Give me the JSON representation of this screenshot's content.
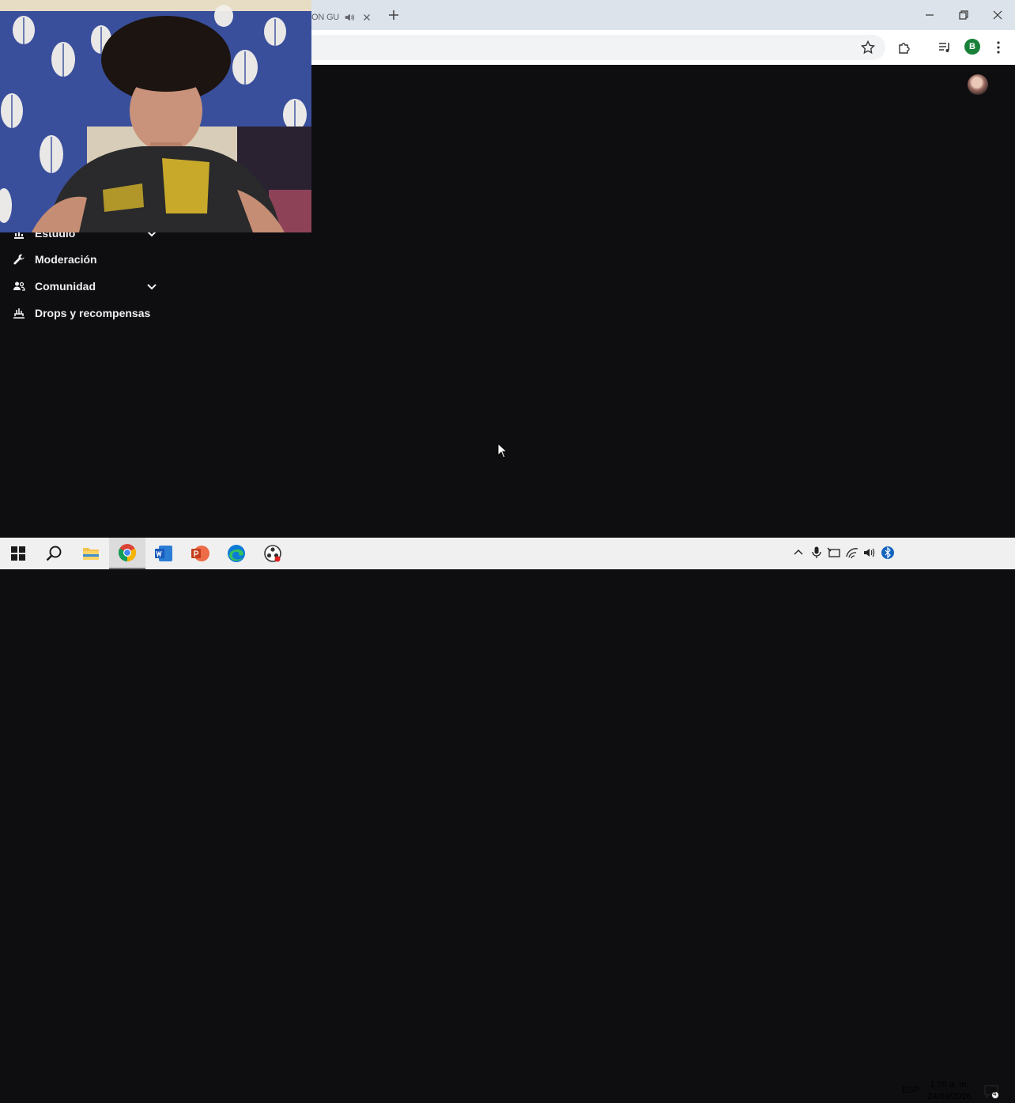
{
  "browser": {
    "tab": {
      "title": "ON GU",
      "audio_icon": "speaker-icon"
    },
    "new_tab_icon": "plus-icon",
    "window_controls": [
      "minimize-icon",
      "restore-icon",
      "close-icon"
    ],
    "toolbar_icons": [
      "star-icon",
      "extensions-icon",
      "media-control-icon",
      "more-menu-icon"
    ],
    "profile_initial": "B",
    "profile_color": "#188038"
  },
  "page": {
    "background": "#0e0e10",
    "sidebar": {
      "items": [
        {
          "label": "Estudio",
          "icon": "chart-icon",
          "has_chevron": true
        },
        {
          "label": "Moderación",
          "icon": "wrench-icon",
          "has_chevron": false
        },
        {
          "label": "Comunidad",
          "icon": "people-icon",
          "has_chevron": true
        },
        {
          "label": "Drops y recompensas",
          "icon": "drops-icon",
          "has_chevron": false
        }
      ]
    }
  },
  "taskbar": {
    "apps": [
      "windows-start-icon",
      "search-icon",
      "file-explorer-icon",
      "chrome-icon",
      "word-icon",
      "powerpoint-icon",
      "edge-icon",
      "obs-icon"
    ],
    "active_app": "chrome-icon",
    "tray_icons": [
      "chevron-up-icon",
      "microphone-icon",
      "tablet-icon",
      "wifi-icon",
      "volume-icon",
      "bluetooth-icon"
    ],
    "language": "ESP",
    "time": "1:05 a. m.",
    "date": "24/03/2026",
    "notification_count": "4"
  }
}
